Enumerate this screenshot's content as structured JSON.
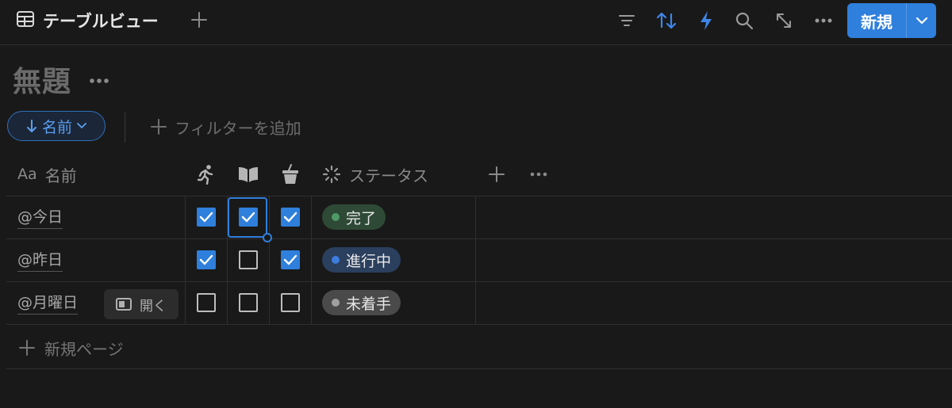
{
  "toolbar": {
    "view_tab_label": "テーブルビュー",
    "new_label": "新規",
    "accent": "#2f7fdc",
    "icons": [
      "table-icon",
      "plus-icon",
      "filter-icon",
      "sort-icon",
      "lightning-icon",
      "search-icon",
      "expand-icon",
      "more-icon",
      "chevron-down-icon"
    ]
  },
  "page": {
    "title": "無題"
  },
  "filters": {
    "sort_label": "名前",
    "add_filter_label": "フィルターを追加"
  },
  "table": {
    "columns": {
      "name": "名前",
      "name_type": "Aa",
      "status": "ステータス",
      "icon_columns": [
        "run-icon",
        "book-icon",
        "cup-icon"
      ]
    },
    "rows": [
      {
        "name": "@今日",
        "checks": [
          true,
          true,
          true
        ],
        "status": "完了",
        "status_color": "#4f9a66",
        "status_bg": "#2e4a36"
      },
      {
        "name": "@昨日",
        "checks": [
          true,
          false,
          true
        ],
        "status": "進行中",
        "status_color": "#3d7de0",
        "status_bg": "#2b3f5e"
      },
      {
        "name": "@月曜日",
        "checks": [
          false,
          false,
          false
        ],
        "status": "未着手",
        "status_color": "#a0a0a0",
        "status_bg": "#4a4a4a"
      }
    ],
    "open_label": "開く",
    "new_page_label": "新規ページ"
  }
}
